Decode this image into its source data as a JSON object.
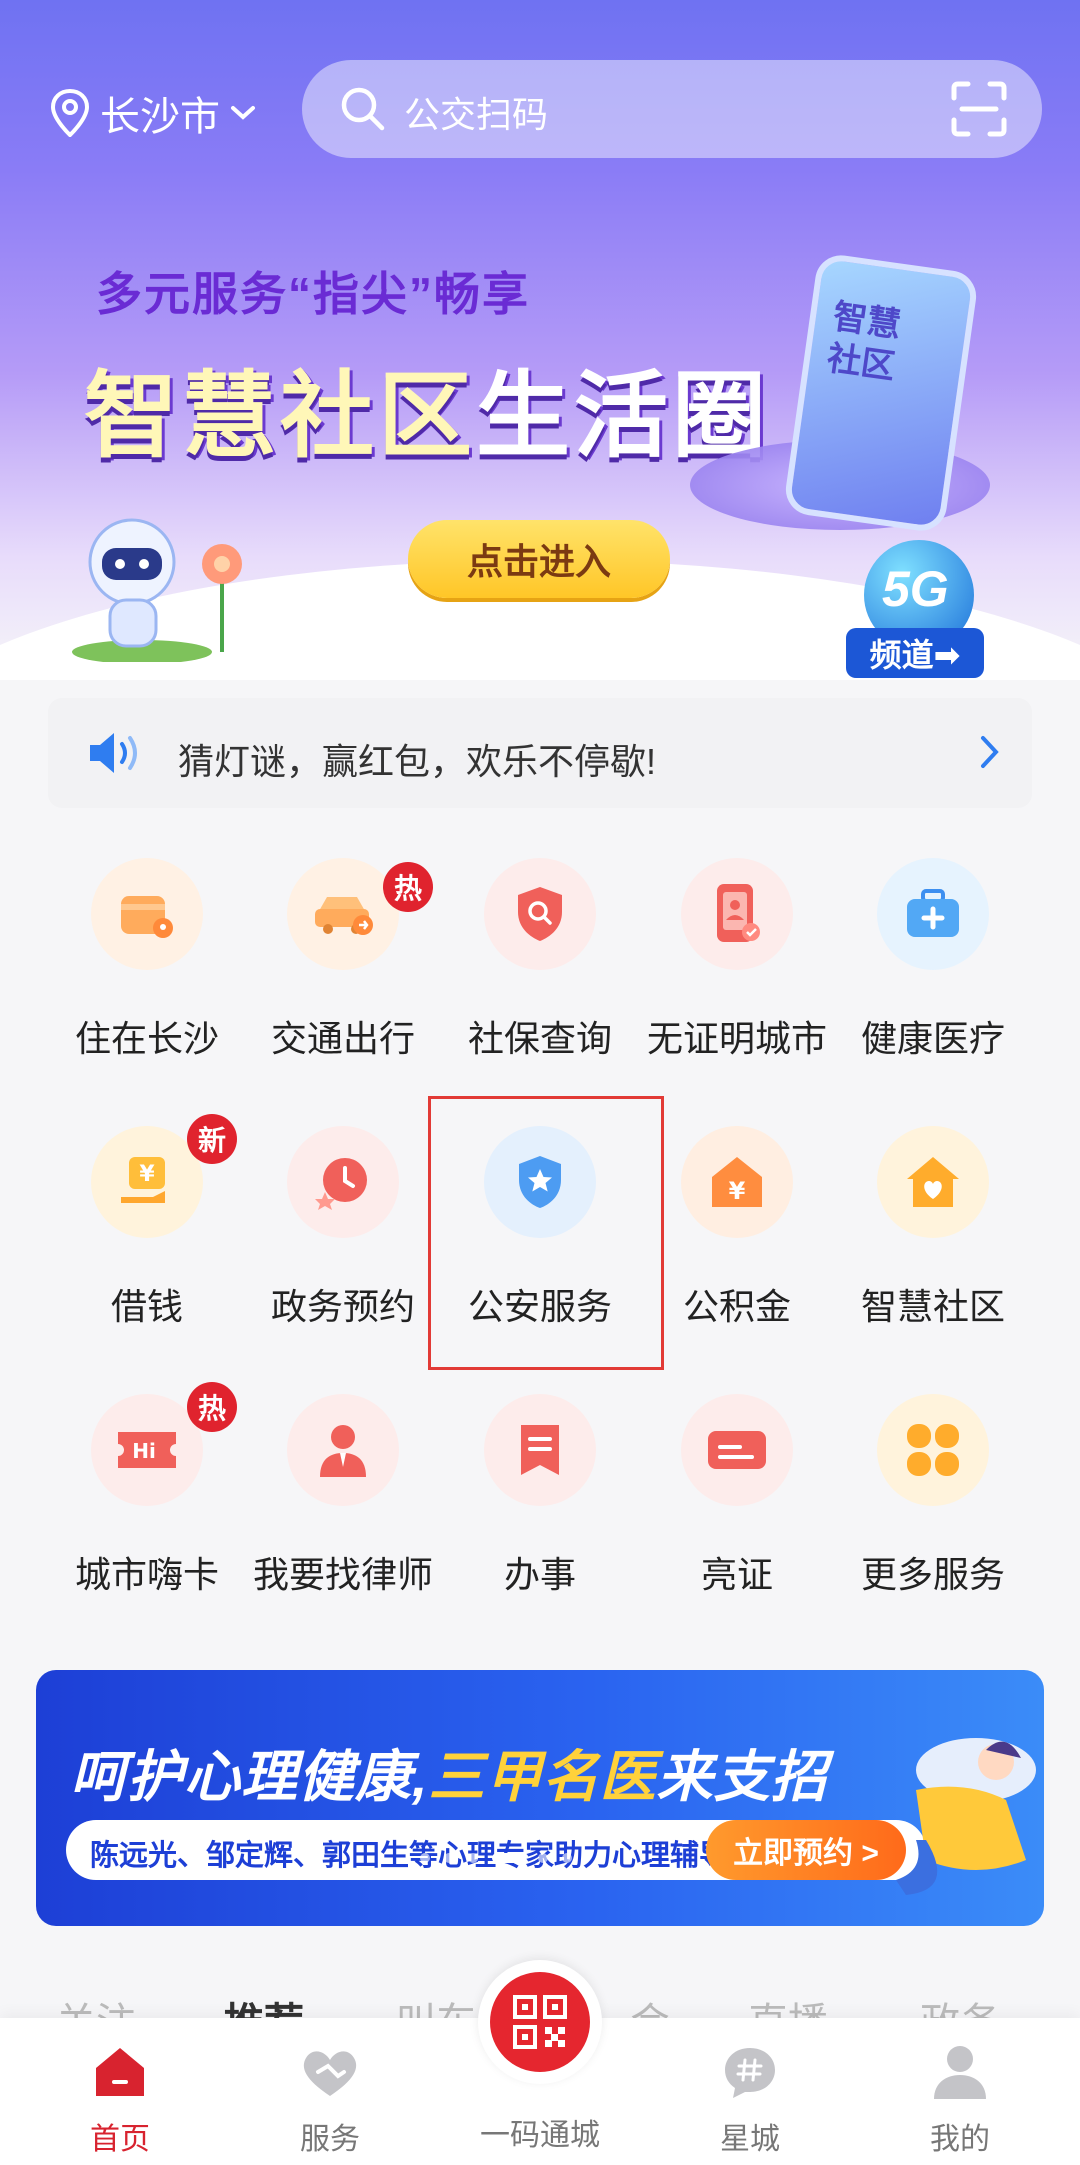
{
  "header": {
    "city": "长沙市",
    "search_placeholder": "公交扫码"
  },
  "hero": {
    "subtitle": "多元服务“指尖”畅享",
    "title_a": "智慧社区",
    "title_b": "生活圈",
    "enter_button": "点击进入",
    "phone_text_1": "智慧",
    "phone_text_2": "社区",
    "badge_5g": "5G",
    "badge_channel": "频道➡"
  },
  "notice": {
    "text": "猜灯谜，赢红包，欢乐不停歇!"
  },
  "services": [
    {
      "label": "住在长沙",
      "icon": "wallet-location-icon",
      "color": "#ff9a4a"
    },
    {
      "label": "交通出行",
      "icon": "car-icon",
      "color": "#ff9a4a",
      "tag": "热"
    },
    {
      "label": "社保查询",
      "icon": "shield-search-icon",
      "color": "#f05a52"
    },
    {
      "label": "无证明城市",
      "icon": "phone-id-icon",
      "color": "#f05a52"
    },
    {
      "label": "健康医疗",
      "icon": "medical-kit-icon",
      "color": "#45a6f5"
    },
    {
      "label": "借钱",
      "icon": "yuan-hand-icon",
      "color": "#ffb02e",
      "tag": "新"
    },
    {
      "label": "政务预约",
      "icon": "clock-icon",
      "color": "#f05a52"
    },
    {
      "label": "公安服务",
      "icon": "police-badge-icon",
      "color": "#4a9bf2"
    },
    {
      "label": "公积金",
      "icon": "yuan-house-icon",
      "color": "#ff8a3a"
    },
    {
      "label": "智慧社区",
      "icon": "heart-house-icon",
      "color": "#ffa72e"
    },
    {
      "label": "城市嗨卡",
      "icon": "hi-ticket-icon",
      "color": "#f05a52",
      "tag": "热"
    },
    {
      "label": "我要找律师",
      "icon": "lawyer-icon",
      "color": "#f05a52"
    },
    {
      "label": "办事",
      "icon": "bookmark-doc-icon",
      "color": "#f05a52"
    },
    {
      "label": "亮证",
      "icon": "card-icon",
      "color": "#f05a52"
    },
    {
      "label": "更多服务",
      "icon": "four-petal-icon",
      "color": "#ffac2c"
    }
  ],
  "promo": {
    "headline_a": "呵护心理健康,",
    "headline_b": "三甲名医",
    "headline_c": "来支招",
    "sub": "陈远光、邹定辉、郭田生等心理专家助力心理辅导",
    "cta": "立即预约 >"
  },
  "tabstrip": [
    "关注",
    "推荐",
    "叫车",
    "会",
    "直播",
    "政务"
  ],
  "bottom_nav": {
    "home": "首页",
    "services": "服务",
    "center": "一码通城",
    "star_city": "星城",
    "mine": "我的"
  },
  "colors": {
    "accent": "#e5262f",
    "hero_purple": "#7c6ff3"
  }
}
